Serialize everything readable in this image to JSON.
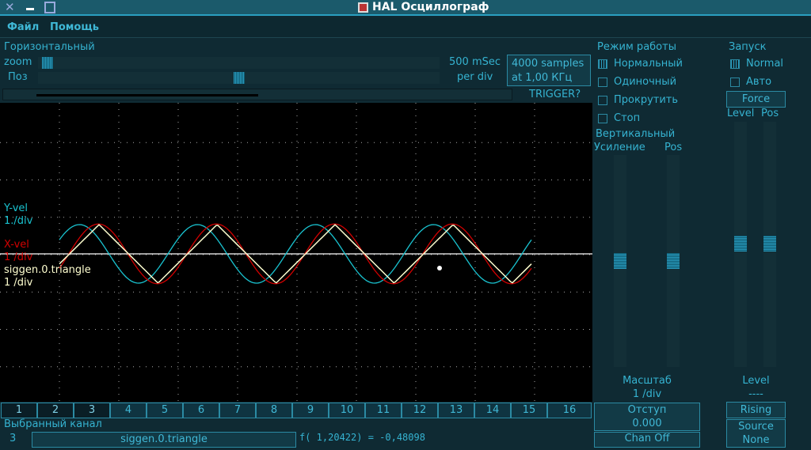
{
  "window": {
    "title": "HAL Осциллограф"
  },
  "menu": [
    "Файл",
    "Помощь"
  ],
  "horizontal": {
    "label": "Горизонтальный",
    "zoom_label": "zoom",
    "pos_label": "Поз",
    "time_per_div": "500 mSec",
    "per_div": "per div",
    "samples": "4000 samples",
    "rate": "at 1,00 КГц",
    "trigger_btn": "TRIGGER?",
    "zoom_value": 0.01,
    "pos_value": 0.5
  },
  "mode": {
    "label": "Режим работы",
    "options": [
      {
        "label": "Нормальный",
        "checked": true
      },
      {
        "label": "Одиночный",
        "checked": false
      },
      {
        "label": "Прокрутить",
        "checked": false
      },
      {
        "label": "Стоп",
        "checked": false
      }
    ]
  },
  "vertical": {
    "label": "Вертикальный",
    "gain_label": "Усиление",
    "pos_label": "Pos",
    "scale_label": "Масштаб",
    "scale_value": "1 /div",
    "offset_label": "Отступ",
    "offset_value": "0.000",
    "chan_off": "Chan Off"
  },
  "trigger": {
    "label": "Запуск",
    "options": [
      {
        "label": "Normal",
        "checked": true
      },
      {
        "label": "Авто",
        "checked": false
      }
    ],
    "force": "Force",
    "level_label": "Level",
    "pos_label": "Pos",
    "level_title": "Level",
    "level_value": "----",
    "edge": "Rising",
    "source_label": "Source",
    "source_value": "None"
  },
  "traces": [
    {
      "name": "Y-vel",
      "scale": "1./div",
      "color": "#19c3d0"
    },
    {
      "name": "X-vel",
      "scale": "1 /div",
      "color": "#d20000"
    },
    {
      "name": "siggen.0.triangle",
      "scale": "1 /div",
      "color": "#ffffd0"
    }
  ],
  "channels": [
    "1",
    "2",
    "3",
    "4",
    "5",
    "6",
    "7",
    "8",
    "9",
    "10",
    "11",
    "12",
    "13",
    "14",
    "15",
    "16"
  ],
  "active_channels": 3,
  "selected": {
    "label": "Выбранный канал",
    "number": "3",
    "name": "siggen.0.triangle",
    "readout": "f( 1,20422) = -0,48098"
  }
}
